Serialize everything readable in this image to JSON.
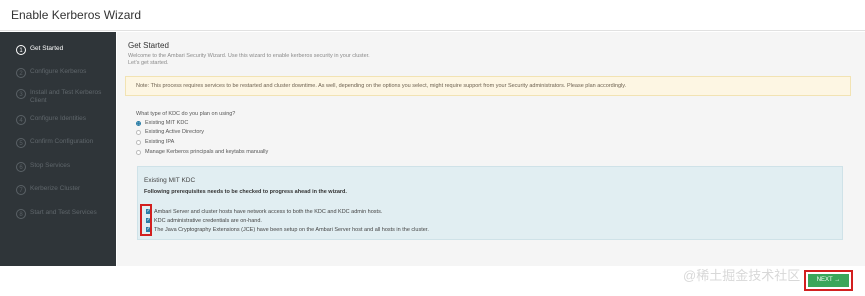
{
  "window": {
    "title": "Enable Kerberos Wizard"
  },
  "sidebar": {
    "steps": [
      {
        "num": "1",
        "label": "Get Started"
      },
      {
        "num": "2",
        "label": "Configure Kerberos"
      },
      {
        "num": "3",
        "label": "Install and Test Kerberos Client"
      },
      {
        "num": "4",
        "label": "Configure Identities"
      },
      {
        "num": "5",
        "label": "Confirm Configuration"
      },
      {
        "num": "6",
        "label": "Stop Services"
      },
      {
        "num": "7",
        "label": "Kerberize Cluster"
      },
      {
        "num": "8",
        "label": "Start and Test Services"
      }
    ]
  },
  "main": {
    "title": "Get Started",
    "intro_line1": "Welcome to the Ambari Security Wizard. Use this wizard to enable kerberos security in your cluster.",
    "intro_line2": "Let's get started.",
    "note": "Note: This process requires services to be restarted and cluster downtime. As well, depending on the options you select, might require support from your Security administrators. Please plan accordingly.",
    "kdc_question": "What type of KDC do you plan on using?",
    "kdc_options": [
      "Existing MIT KDC",
      "Existing Active Directory",
      "Existing IPA",
      "Manage Kerberos principals and keytabs manually"
    ],
    "selected_option": "Existing MIT KDC",
    "panel": {
      "title": "Existing MIT KDC",
      "subtitle": "Following prerequisites needs to be checked to progress ahead in the wizard.",
      "checks": [
        "Ambari Server and cluster hosts have network access to both the KDC and KDC admin hosts.",
        "KDC administrative credentials are on-hand.",
        "The Java Cryptography Extensions (JCE) have been setup on the Ambari Server host and all hosts in the cluster."
      ]
    }
  },
  "footer": {
    "next_label": "NEXT →",
    "watermark": "@稀土掘金技术社区"
  }
}
